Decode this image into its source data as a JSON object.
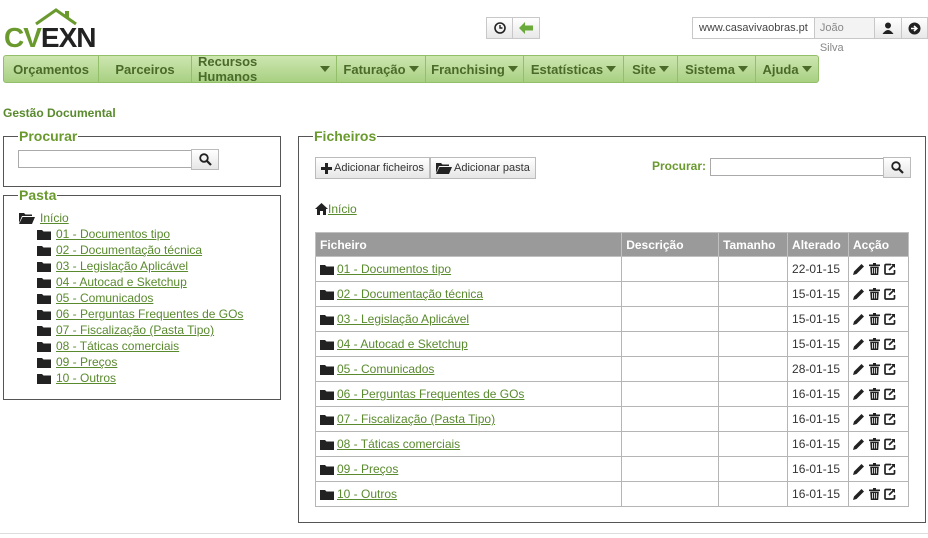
{
  "brand": {
    "logo_cv": "CV",
    "logo_exn": "EXN",
    "accent": "#6a9a2e"
  },
  "header": {
    "site": "www.casavivaobras.pt",
    "user": "João Silva"
  },
  "nav": [
    {
      "label": "Orçamentos",
      "dropdown": false,
      "w": 96
    },
    {
      "label": "Parceiros",
      "dropdown": false,
      "w": 93
    },
    {
      "label": "Recursos Humanos",
      "dropdown": true,
      "w": 145
    },
    {
      "label": "Faturação",
      "dropdown": true,
      "w": 89
    },
    {
      "label": "Franchising",
      "dropdown": true,
      "w": 98
    },
    {
      "label": "Estatísticas",
      "dropdown": true,
      "w": 100
    },
    {
      "label": "Site",
      "dropdown": true,
      "w": 54
    },
    {
      "label": "Sistema",
      "dropdown": true,
      "w": 78
    },
    {
      "label": "Ajuda",
      "dropdown": true,
      "w": 63
    }
  ],
  "page_title": "Gestão Documental",
  "procurar": {
    "legend": "Procurar",
    "value": ""
  },
  "pasta": {
    "legend": "Pasta",
    "root": "Início",
    "items": [
      "01 - Documentos tipo",
      "02 - Documentação técnica",
      "03 - Legislação Aplicável",
      "04 - Autocad e Sketchup",
      "05 - Comunicados",
      "06 - Perguntas Frequentes de GOs",
      "07 - Fiscalização (Pasta Tipo)",
      "08 - Táticas comerciais",
      "09 - Preços",
      "10 - Outros"
    ]
  },
  "ficheiros": {
    "legend": "Ficheiros",
    "add_files": "Adicionar ficheiros",
    "add_folder": "Adicionar pasta",
    "search_label": "Procurar:",
    "search_value": "",
    "breadcrumb": "Início",
    "columns": [
      "Ficheiro",
      "Descrição",
      "Tamanho",
      "Alterado",
      "Acção"
    ],
    "rows": [
      {
        "name": "01 - Documentos tipo",
        "desc": "",
        "size": "",
        "date": "22-01-15"
      },
      {
        "name": "02 - Documentação técnica",
        "desc": "",
        "size": "",
        "date": "15-01-15"
      },
      {
        "name": "03 - Legislação Aplicável",
        "desc": "",
        "size": "",
        "date": "15-01-15"
      },
      {
        "name": "04 - Autocad e Sketchup",
        "desc": "",
        "size": "",
        "date": "15-01-15"
      },
      {
        "name": "05 - Comunicados",
        "desc": "",
        "size": "",
        "date": "28-01-15"
      },
      {
        "name": "06 - Perguntas Frequentes de GOs",
        "desc": "",
        "size": "",
        "date": "16-01-15"
      },
      {
        "name": "07 - Fiscalização (Pasta Tipo)",
        "desc": "",
        "size": "",
        "date": "16-01-15"
      },
      {
        "name": "08 - Táticas comerciais",
        "desc": "",
        "size": "",
        "date": "16-01-15"
      },
      {
        "name": "09 - Preços",
        "desc": "",
        "size": "",
        "date": "16-01-15"
      },
      {
        "name": "10 - Outros",
        "desc": "",
        "size": "",
        "date": "16-01-15"
      }
    ]
  }
}
